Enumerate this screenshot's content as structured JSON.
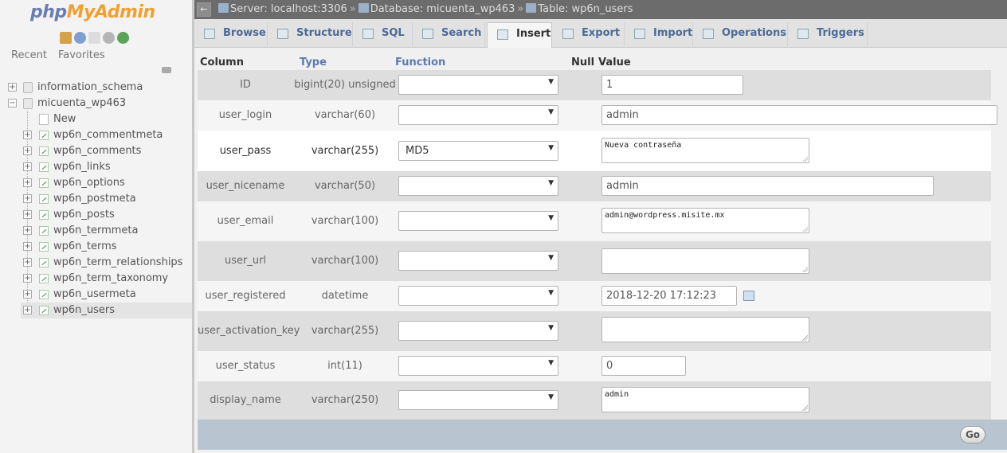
{
  "navigation": {
    "logo_php": "php",
    "logo_myadmin": "MyAdmin",
    "tabs": [
      "Recent",
      "Favorites"
    ],
    "tree": [
      {
        "label": "information_schema",
        "kind": "db"
      },
      {
        "label": "micuenta_wp463",
        "kind": "db"
      },
      {
        "label": "New",
        "kind": "new"
      },
      {
        "label": "wp6n_commentmeta",
        "kind": "table"
      },
      {
        "label": "wp6n_comments",
        "kind": "table"
      },
      {
        "label": "wp6n_links",
        "kind": "table"
      },
      {
        "label": "wp6n_options",
        "kind": "table"
      },
      {
        "label": "wp6n_postmeta",
        "kind": "table"
      },
      {
        "label": "wp6n_posts",
        "kind": "table"
      },
      {
        "label": "wp6n_termmeta",
        "kind": "table"
      },
      {
        "label": "wp6n_terms",
        "kind": "table"
      },
      {
        "label": "wp6n_term_relationships",
        "kind": "table"
      },
      {
        "label": "wp6n_term_taxonomy",
        "kind": "table"
      },
      {
        "label": "wp6n_usermeta",
        "kind": "table"
      },
      {
        "label": "wp6n_users",
        "kind": "table"
      }
    ]
  },
  "breadcrumb": {
    "server": "Server: localhost:3306",
    "database": "Database: micuenta_wp463",
    "table": "Table: wp6n_users"
  },
  "tabs": [
    "Browse",
    "Structure",
    "SQL",
    "Search",
    "Insert",
    "Export",
    "Import",
    "Operations",
    "Triggers"
  ],
  "active_tab": "Insert",
  "table_headers": {
    "column": "Column",
    "type": "Type",
    "function": "Function",
    "null": "Null",
    "value": "Value"
  },
  "rows": [
    {
      "column": "ID",
      "type": "bigint(20) unsigned",
      "function": "",
      "value": "1"
    },
    {
      "column": "user_login",
      "type": "varchar(60)",
      "function": "",
      "value": "admin"
    },
    {
      "column": "user_pass",
      "type": "varchar(255)",
      "function": "MD5",
      "value": "Nueva contraseña"
    },
    {
      "column": "user_nicename",
      "type": "varchar(50)",
      "function": "",
      "value": "admin"
    },
    {
      "column": "user_email",
      "type": "varchar(100)",
      "function": "",
      "value": "admin@wordpress.misite.mx"
    },
    {
      "column": "user_url",
      "type": "varchar(100)",
      "function": "",
      "value": ""
    },
    {
      "column": "user_registered",
      "type": "datetime",
      "function": "",
      "value": "2018-12-20 17:12:23"
    },
    {
      "column": "user_activation_key",
      "type": "varchar(255)",
      "function": "",
      "value": ""
    },
    {
      "column": "user_status",
      "type": "int(11)",
      "function": "",
      "value": "0"
    },
    {
      "column": "display_name",
      "type": "varchar(250)",
      "function": "",
      "value": "admin"
    }
  ],
  "go_label": "Go"
}
